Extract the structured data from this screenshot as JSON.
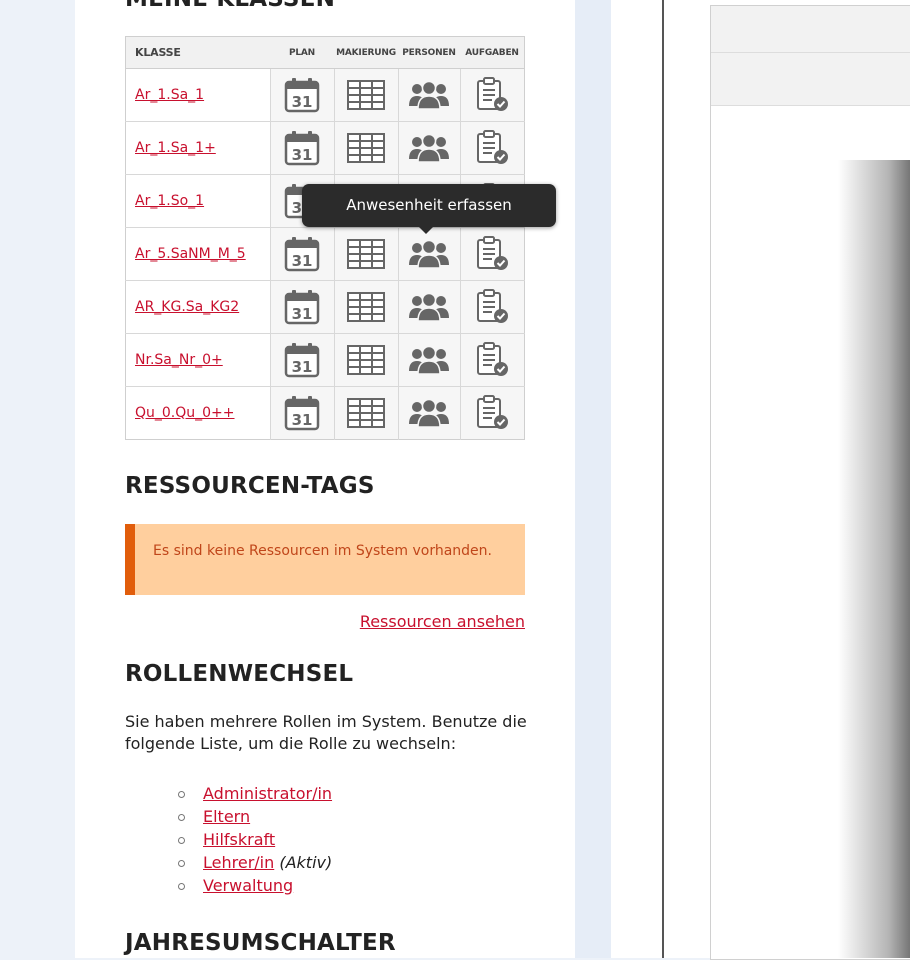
{
  "sections": {
    "klassen_title": "MEINE KLASSEN",
    "tags_title": "RESSOURCEN-TAGS",
    "rollen_title": "ROLLENWECHSEL",
    "jahr_title": "JAHRESUMSCHALTER"
  },
  "table": {
    "headers": [
      "KLASSE",
      "PLAN",
      "MAKIERUNG",
      "PERSONEN",
      "AUFGABEN"
    ],
    "rows": [
      {
        "name": "Ar_1.Sa_1"
      },
      {
        "name": "Ar_1.Sa_1+"
      },
      {
        "name": "Ar_1.So_1"
      },
      {
        "name": "Ar_5.SaNM_M_5"
      },
      {
        "name": "AR_KG.Sa_KG2"
      },
      {
        "name": "Nr.Sa_Nr_0+"
      },
      {
        "name": "Qu_0.Qu_0++"
      }
    ],
    "calendar_day": "31",
    "icons": [
      "calendar-icon",
      "grid-table-icon",
      "people-group-icon",
      "clipboard-check-icon"
    ]
  },
  "tooltip": {
    "text": "Anwesenheit erfassen"
  },
  "resources": {
    "alert_text": "Es sind keine Ressourcen im System vorhanden.",
    "link_text": "Ressourcen ansehen"
  },
  "rollen": {
    "description": "Sie haben mehrere Rollen im System. Benutze die folgende Liste, um die Rolle zu wechseln:",
    "roles": [
      {
        "label": "Administrator/in",
        "note": ""
      },
      {
        "label": "Eltern",
        "note": ""
      },
      {
        "label": "Hilfskraft",
        "note": ""
      },
      {
        "label": "Lehrer/in",
        "note": "(Aktiv)"
      },
      {
        "label": "Verwaltung",
        "note": ""
      }
    ]
  },
  "colors": {
    "link": "#c8102e",
    "alert_bg": "#ffcf9e",
    "alert_border": "#e15d0b",
    "icon_gray": "#666666",
    "tooltip_bg": "#2b2b2b"
  }
}
